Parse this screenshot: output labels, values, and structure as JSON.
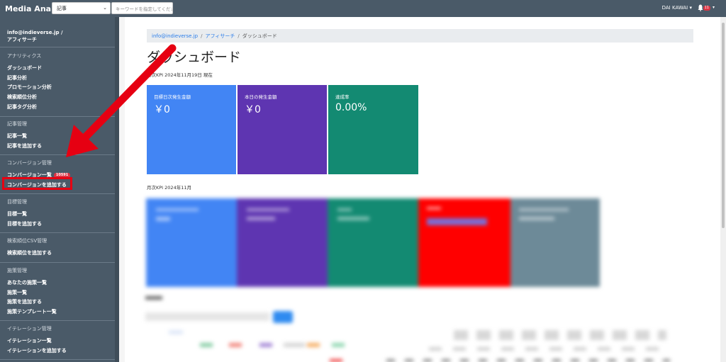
{
  "navbar": {
    "brand": "Media Analytics",
    "select_value": "記事",
    "keyword_placeholder": "キーワードを指定してください",
    "user_name": "DAI KAWAI",
    "notification_count": "11"
  },
  "sidebar": {
    "account_line1": "info@indieverse.jp /",
    "account_line2": "アフィサーチ",
    "sections": [
      {
        "heading": "アナリティクス",
        "items": [
          "ダッシュボード",
          "記事分析",
          "プロモーション分析",
          "検索順位分析",
          "記事タグ分析"
        ]
      },
      {
        "heading": "記事管理",
        "items": [
          "記事一覧",
          "記事を追加する"
        ]
      },
      {
        "heading": "コンバージョン管理",
        "items": [
          "コンバージョン一覧",
          "コンバージョンを追加する"
        ],
        "badge": "10591"
      },
      {
        "heading": "目標管理",
        "items": [
          "目標一覧",
          "目標を追加する"
        ]
      },
      {
        "heading": "検索順位CSV管理",
        "items": [
          "検索順位を追加する"
        ]
      },
      {
        "heading": "施策管理",
        "items": [
          "あなたの施策一覧",
          "施策一覧",
          "施策を追加する",
          "施策テンプレート一覧"
        ]
      },
      {
        "heading": "イテレーション管理",
        "items": [
          "イテレーション一覧",
          "イテレーションを追加する"
        ]
      }
    ]
  },
  "breadcrumb": {
    "items": [
      "info@indieverse.jp",
      "アフィサーチ",
      "ダッシュボード"
    ],
    "separator": "/"
  },
  "page": {
    "title": "ダッシュボード",
    "daily_caption": "日次KPI 2024年11月19日 現在",
    "monthly_caption": "月次KPI 2024年11月"
  },
  "daily_kpis": [
    {
      "label": "目標日次発生金額",
      "value": "￥0",
      "color": "#4285f4"
    },
    {
      "label": "本日の発生金額",
      "value": "￥0",
      "color": "#5e35b1"
    },
    {
      "label": "達成率",
      "value": "0.00%",
      "color": "#138a72"
    }
  ],
  "monthly_colors": [
    "#4285f4",
    "#5e35b1",
    "#138a72",
    "#ff0000",
    "#6d8a98"
  ],
  "annotation": {
    "arrow_color": "#e60012",
    "highlight_color": "#e60012"
  }
}
